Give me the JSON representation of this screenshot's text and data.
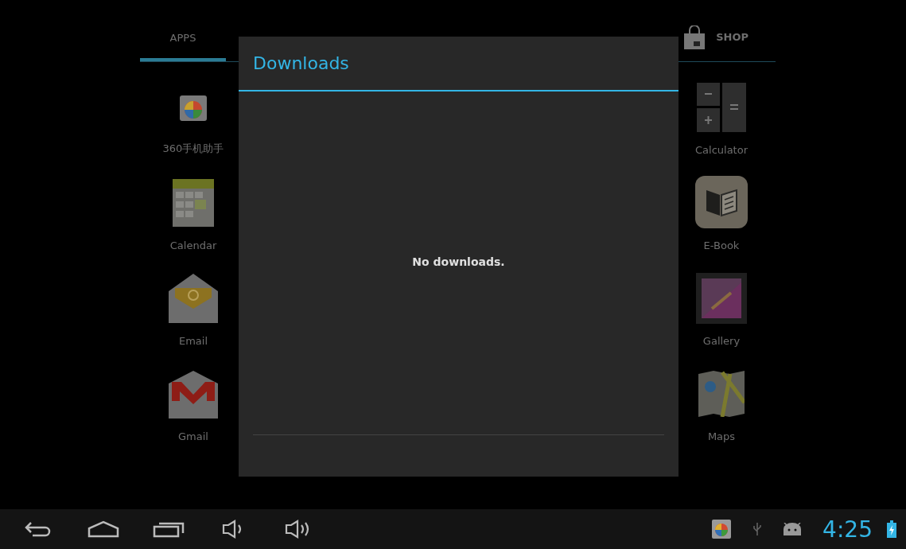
{
  "launcher": {
    "tabs": [
      {
        "label": "APPS",
        "selected": true
      }
    ],
    "shop": {
      "label": "SHOP"
    },
    "left_apps": [
      {
        "label": "360手机助手",
        "kind": "store"
      },
      {
        "label": "Calendar",
        "kind": "calendar"
      },
      {
        "label": "Email",
        "kind": "email"
      },
      {
        "label": "Gmail",
        "kind": "gmail"
      }
    ],
    "right_apps": [
      {
        "label": "Calculator",
        "kind": "calculator"
      },
      {
        "label": "E-Book",
        "kind": "ebook"
      },
      {
        "label": "Gallery",
        "kind": "gallery"
      },
      {
        "label": "Maps",
        "kind": "maps"
      }
    ]
  },
  "dialog": {
    "title": "Downloads",
    "message": "No downloads."
  },
  "nav_bar": {
    "buttons": [
      {
        "kind": "back"
      },
      {
        "kind": "home"
      },
      {
        "kind": "recent"
      },
      {
        "kind": "volume_down"
      },
      {
        "kind": "volume_up"
      }
    ],
    "status": {
      "notifications": [
        {
          "kind": "store"
        },
        {
          "kind": "usb"
        },
        {
          "kind": "android"
        }
      ],
      "clock": "4:25"
    }
  }
}
